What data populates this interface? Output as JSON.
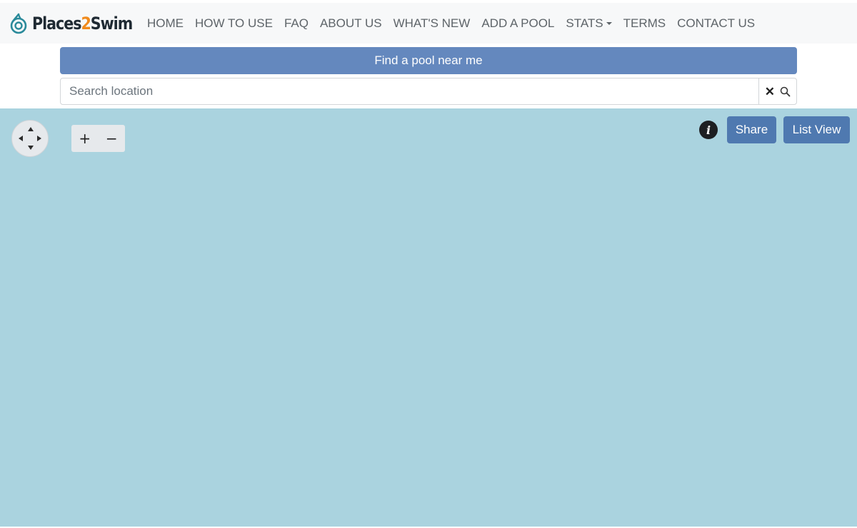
{
  "brand": {
    "name_part1": "Places",
    "name_part2": "2",
    "name_part3": "Swim",
    "logo_icon": "water-drop-swirl-icon",
    "accent_color": "#f08a1c",
    "icon_color": "#2a8a9a"
  },
  "nav": {
    "items": [
      {
        "label": "HOME"
      },
      {
        "label": "HOW TO USE"
      },
      {
        "label": "FAQ"
      },
      {
        "label": "ABOUT US"
      },
      {
        "label": "WHAT'S NEW"
      },
      {
        "label": "ADD A POOL"
      },
      {
        "label": "STATS",
        "has_dropdown": true
      },
      {
        "label": "TERMS"
      },
      {
        "label": "CONTACT US"
      }
    ]
  },
  "find_pool": {
    "label": "Find a pool near me",
    "color": "#6488be"
  },
  "search": {
    "placeholder": "Search location",
    "value": "",
    "clear_icon": "close-icon",
    "search_icon": "search-icon"
  },
  "map": {
    "water_color": "#aad3df",
    "zoom_in_label": "+",
    "zoom_out_label": "−",
    "info_label": "i",
    "share_label": "Share",
    "list_view_label": "List View",
    "button_color": "#4f79b0"
  }
}
